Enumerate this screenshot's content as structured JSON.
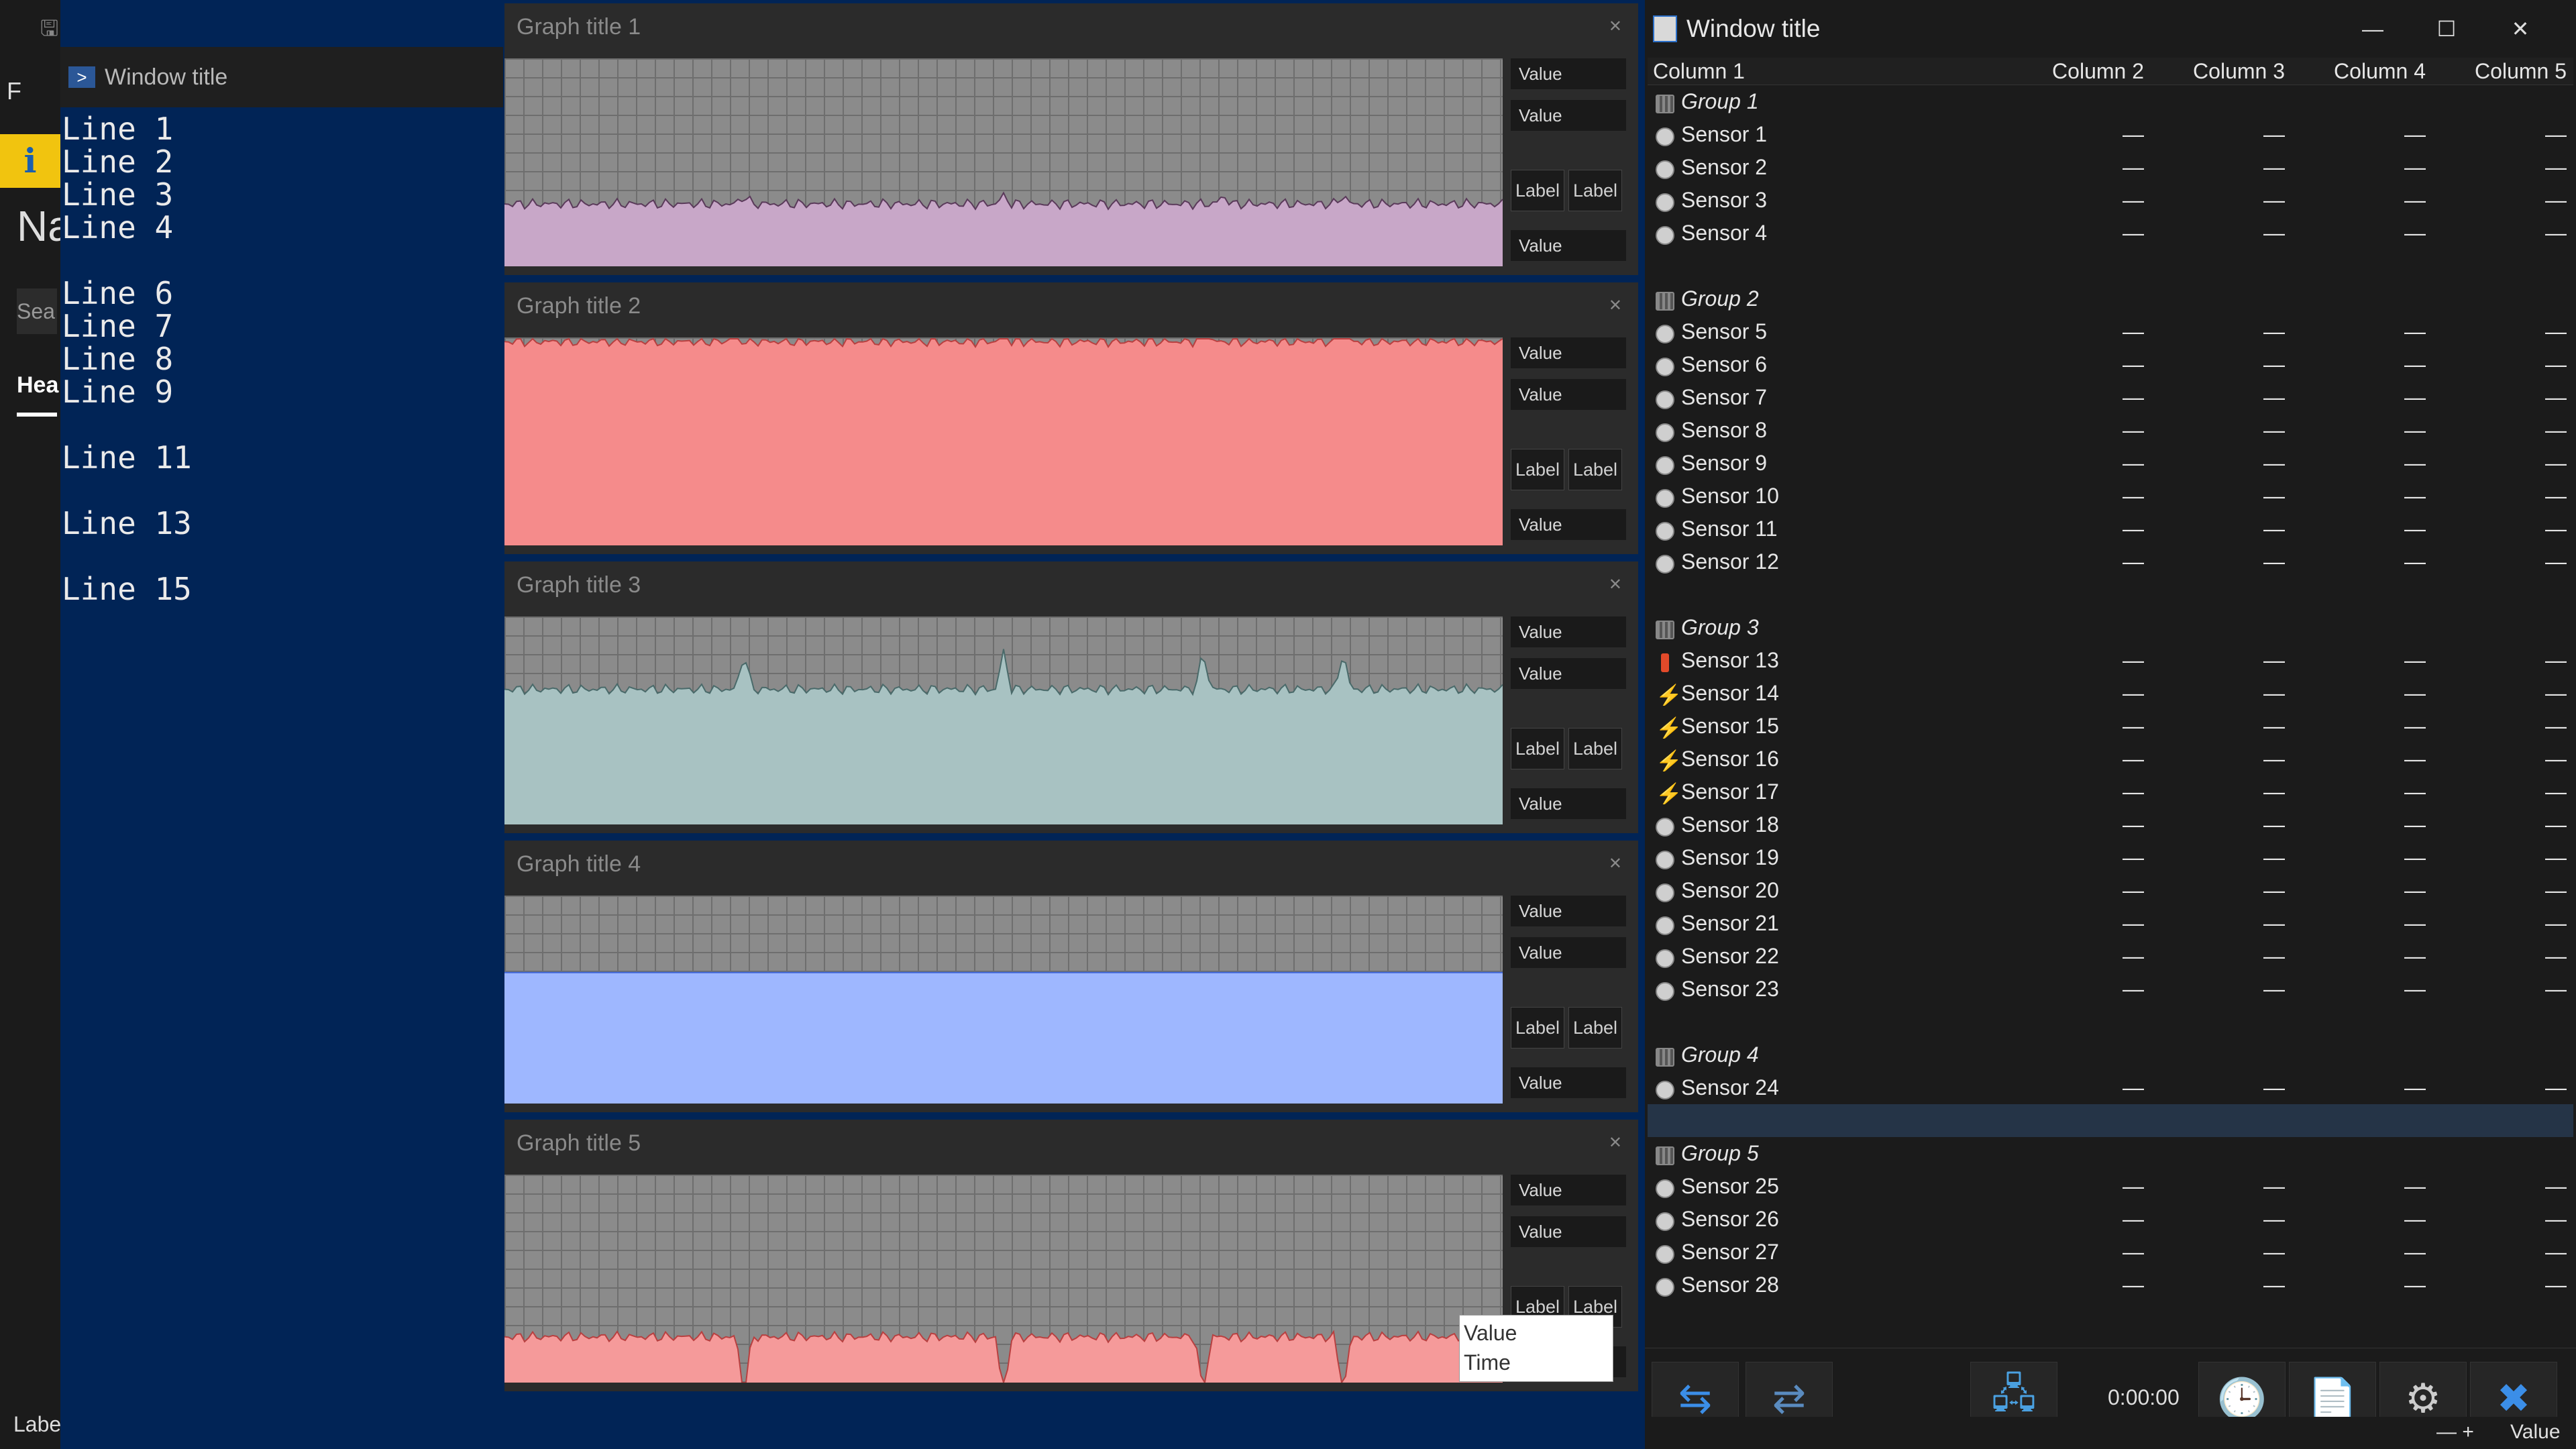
{
  "powershell": {
    "title": "Window title",
    "lines": [
      "Line 1",
      "Line 2",
      "Line 3",
      "Line 4",
      "",
      "Line 6",
      "Line 7",
      "Line 8",
      "Line 9",
      "",
      "Line 11",
      "",
      "Line 13",
      "",
      "Line 15"
    ],
    "cursor": "_"
  },
  "graphs": [
    {
      "title": "Graph title 1",
      "max": "Value",
      "current": "Value",
      "min": "Value",
      "fit": "Label",
      "reset": "Label",
      "color": "#c8a7c8",
      "stroke": "#5a3a5a"
    },
    {
      "title": "Graph title 2",
      "max": "Value",
      "current": "Value",
      "min": "Value",
      "fit": "Label",
      "reset": "Label",
      "color": "#f58b8b",
      "stroke": "#b84040"
    },
    {
      "title": "Graph title 3",
      "max": "Value",
      "current": "Value",
      "min": "Value",
      "fit": "Label",
      "reset": "Label",
      "color": "#a8c2c2",
      "stroke": "#4a6a6a"
    },
    {
      "title": "Graph title 4",
      "max": "Value",
      "current": "Value",
      "min": "Value",
      "fit": "Label",
      "reset": "Label",
      "color": "#9eb7ff",
      "stroke": "#3f66d8"
    },
    {
      "title": "Graph title 5",
      "max": "Value",
      "current": "Value",
      "min": "Value",
      "fit": "Label",
      "reset": "Label",
      "color": "#f59a9a",
      "stroke": "#b84040"
    }
  ],
  "tooltip": {
    "value": "Value",
    "time": "Time"
  },
  "hwinfo": {
    "title": "Window title",
    "columns": [
      "Column 1",
      "Column 2",
      "Column 3",
      "Column 4",
      "Column 5"
    ],
    "rows": [
      {
        "type": "group",
        "label": "Group 1"
      },
      {
        "type": "row",
        "icon": "circle",
        "label": "Sensor 1",
        "v": [
          "—",
          "—",
          "—",
          "—"
        ]
      },
      {
        "type": "row",
        "icon": "circle",
        "label": "Sensor 2",
        "v": [
          "—",
          "—",
          "—",
          "—"
        ]
      },
      {
        "type": "row",
        "icon": "circle",
        "label": "Sensor 3",
        "v": [
          "—",
          "—",
          "—",
          "—"
        ]
      },
      {
        "type": "row",
        "icon": "circle",
        "label": "Sensor 4",
        "v": [
          "—",
          "—",
          "—",
          "—"
        ]
      },
      {
        "type": "spacer"
      },
      {
        "type": "group",
        "label": "Group 2"
      },
      {
        "type": "row",
        "icon": "circle",
        "label": "Sensor 5",
        "v": [
          "—",
          "—",
          "—",
          "—"
        ]
      },
      {
        "type": "row",
        "icon": "circle",
        "label": "Sensor 6",
        "v": [
          "—",
          "—",
          "—",
          "—"
        ]
      },
      {
        "type": "row",
        "icon": "circle",
        "label": "Sensor 7",
        "v": [
          "—",
          "—",
          "—",
          "—"
        ]
      },
      {
        "type": "row",
        "icon": "circle",
        "label": "Sensor 8",
        "v": [
          "—",
          "—",
          "—",
          "—"
        ]
      },
      {
        "type": "row",
        "icon": "circle",
        "label": "Sensor 9",
        "v": [
          "—",
          "—",
          "—",
          "—"
        ]
      },
      {
        "type": "row",
        "icon": "circle",
        "label": "Sensor 10",
        "v": [
          "—",
          "—",
          "—",
          "—"
        ]
      },
      {
        "type": "row",
        "icon": "circle",
        "label": "Sensor 11",
        "v": [
          "—",
          "—",
          "—",
          "—"
        ]
      },
      {
        "type": "row",
        "icon": "circle",
        "label": "Sensor 12",
        "v": [
          "—",
          "—",
          "—",
          "—"
        ]
      },
      {
        "type": "spacer"
      },
      {
        "type": "group",
        "label": "Group 3"
      },
      {
        "type": "row",
        "icon": "temp",
        "label": "Sensor 13",
        "v": [
          "—",
          "—",
          "—",
          "—"
        ]
      },
      {
        "type": "row",
        "icon": "bolt",
        "label": "Sensor 14",
        "v": [
          "—",
          "—",
          "—",
          "—"
        ]
      },
      {
        "type": "row",
        "icon": "bolt",
        "label": "Sensor 15",
        "v": [
          "—",
          "—",
          "—",
          "—"
        ]
      },
      {
        "type": "row",
        "icon": "bolt",
        "label": "Sensor 16",
        "v": [
          "—",
          "—",
          "—",
          "—"
        ]
      },
      {
        "type": "row",
        "icon": "bolt",
        "label": "Sensor 17",
        "v": [
          "—",
          "—",
          "—",
          "—"
        ]
      },
      {
        "type": "row",
        "icon": "circle",
        "label": "Sensor 18",
        "v": [
          "—",
          "—",
          "—",
          "—"
        ]
      },
      {
        "type": "row",
        "icon": "circle",
        "label": "Sensor 19",
        "v": [
          "—",
          "—",
          "—",
          "—"
        ]
      },
      {
        "type": "row",
        "icon": "circle",
        "label": "Sensor 20",
        "v": [
          "—",
          "—",
          "—",
          "—"
        ]
      },
      {
        "type": "row",
        "icon": "circle",
        "label": "Sensor 21",
        "v": [
          "—",
          "—",
          "—",
          "—"
        ]
      },
      {
        "type": "row",
        "icon": "circle",
        "label": "Sensor 22",
        "v": [
          "—",
          "—",
          "—",
          "—"
        ]
      },
      {
        "type": "row",
        "icon": "circle",
        "label": "Sensor 23",
        "v": [
          "—",
          "—",
          "—",
          "—"
        ]
      },
      {
        "type": "spacer"
      },
      {
        "type": "group",
        "label": "Group 4"
      },
      {
        "type": "row",
        "icon": "circle",
        "label": "Sensor 24",
        "v": [
          "—",
          "—",
          "—",
          "—"
        ]
      },
      {
        "type": "spacer",
        "selected": true
      },
      {
        "type": "group",
        "label": "Group 5"
      },
      {
        "type": "row",
        "icon": "circle",
        "label": "Sensor 25",
        "v": [
          "—",
          "—",
          "—",
          "—"
        ]
      },
      {
        "type": "row",
        "icon": "circle",
        "label": "Sensor 26",
        "v": [
          "—",
          "—",
          "—",
          "—"
        ]
      },
      {
        "type": "row",
        "icon": "circle",
        "label": "Sensor 27",
        "v": [
          "—",
          "—",
          "—",
          "—"
        ]
      },
      {
        "type": "row",
        "icon": "circle",
        "label": "Sensor 28",
        "v": [
          "—",
          "—",
          "—",
          "—"
        ]
      }
    ],
    "timer": "0:00:00"
  },
  "statusbar": {
    "zoom": "Value"
  },
  "left_strip": {
    "page_label": "Label",
    "file_label": "F",
    "na_label": "Na",
    "sea_label": "Sea",
    "hea_label": "Hea"
  }
}
